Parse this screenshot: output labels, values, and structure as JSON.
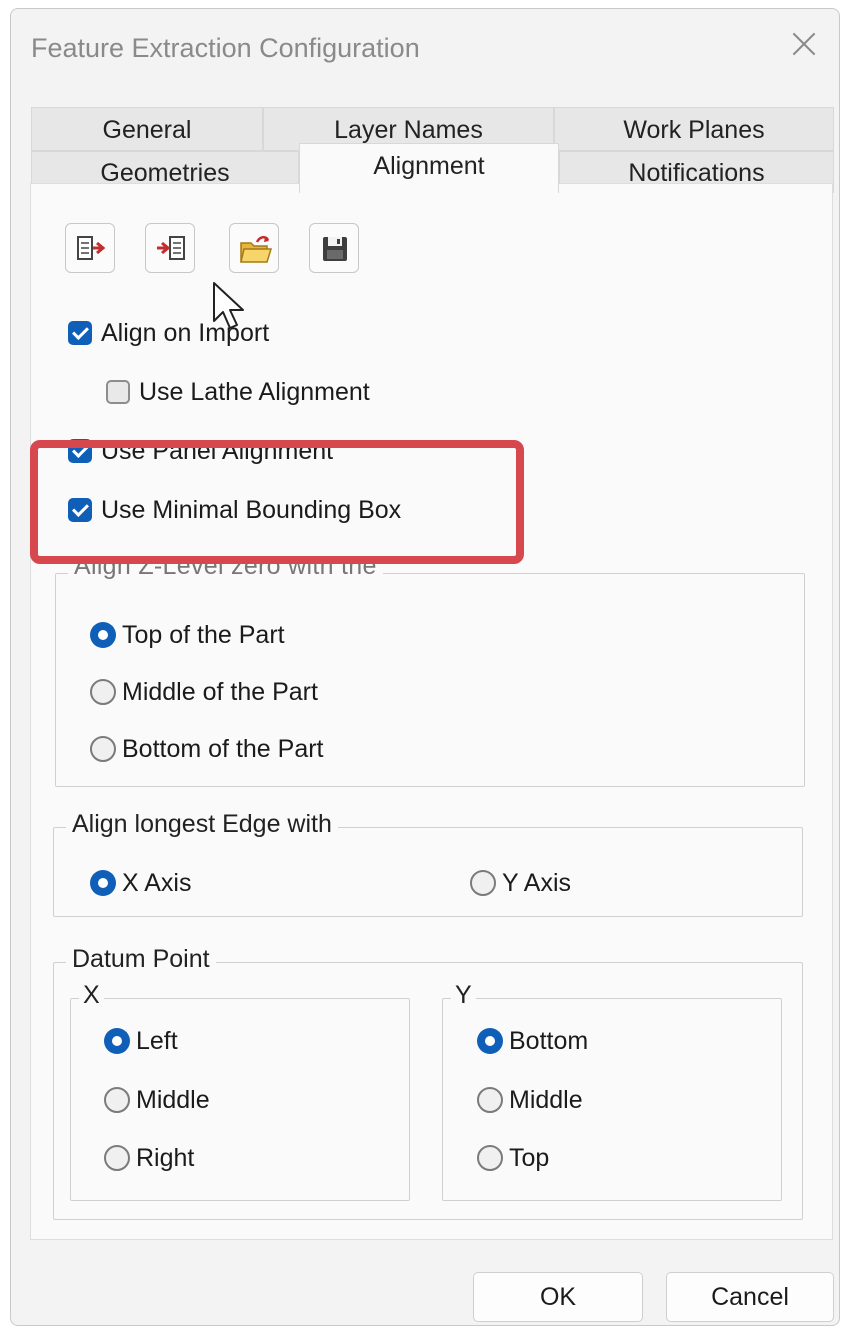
{
  "window": {
    "title": "Feature Extraction Configuration"
  },
  "tabs": {
    "back_row": [
      "General",
      "Layer Names",
      "Work Planes"
    ],
    "front_row": [
      "Geometries",
      "Alignment",
      "Notifications"
    ],
    "active": "Alignment"
  },
  "toolbar": {
    "icons": [
      "export-icon",
      "import-icon",
      "open-folder-icon",
      "save-icon"
    ]
  },
  "options": {
    "align_on_import": {
      "label": "Align on Import",
      "checked": true
    },
    "use_lathe_alignment": {
      "label": "Use Lathe Alignment",
      "checked": false
    },
    "use_panel_alignment": {
      "label": "Use Panel Alignment",
      "checked": true
    },
    "use_minimal_bounding_box": {
      "label": "Use Minimal Bounding Box",
      "checked": true
    }
  },
  "z_level_group": {
    "legend": "Align Z-Level zero with the",
    "options": [
      "Top of the Part",
      "Middle of the Part",
      "Bottom of the Part"
    ],
    "selected": "Top of the Part"
  },
  "longest_edge_group": {
    "legend": "Align longest Edge with",
    "options": [
      "X Axis",
      "Y Axis"
    ],
    "selected": "X Axis"
  },
  "datum_group": {
    "legend": "Datum Point",
    "x": {
      "legend": "X",
      "options": [
        "Left",
        "Middle",
        "Right"
      ],
      "selected": "Left"
    },
    "y": {
      "legend": "Y",
      "options": [
        "Bottom",
        "Middle",
        "Top"
      ],
      "selected": "Bottom"
    }
  },
  "footer": {
    "ok": "OK",
    "cancel": "Cancel"
  },
  "colors": {
    "accent": "#0f5fb8",
    "highlight": "#d7484e"
  }
}
